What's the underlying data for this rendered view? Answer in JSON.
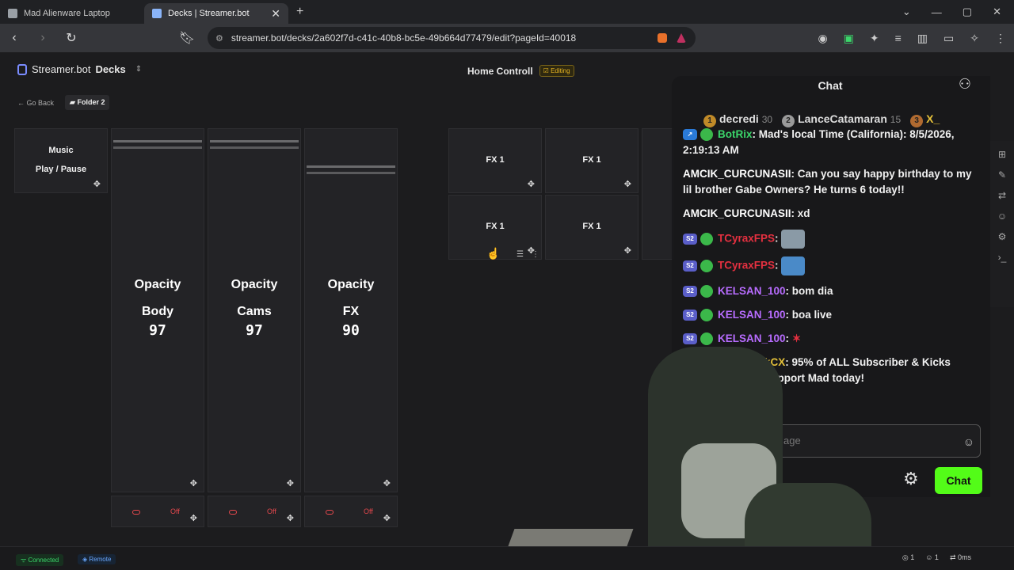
{
  "browser": {
    "tabs": [
      {
        "title": "Mad Alienware Laptop",
        "active": false
      },
      {
        "title": "Decks | Streamer.bot",
        "active": true
      }
    ],
    "new_tab": "+",
    "window_controls": [
      "⌄",
      "—",
      "▢",
      "✕"
    ],
    "url": "streamer.bot/decks/2a602f7d-c41c-40b8-bc5e-49b664d77479/edit?pageId=40018"
  },
  "header": {
    "brand": "Streamer.bot",
    "brand_section": "Decks",
    "page_title": "Home Controll",
    "editing_badge": "Editing"
  },
  "breadcrumb": {
    "back": "Go Back",
    "folder": "Folder 2"
  },
  "buttons": {
    "music": {
      "line1": "Music",
      "line2": "Play / Pause"
    },
    "fx": [
      "FX 1",
      "FX 1",
      "FX 1",
      "FX 1"
    ]
  },
  "sliders": [
    {
      "title": "Opacity",
      "target": "Body",
      "value": "97",
      "toggle": "Off"
    },
    {
      "title": "Opacity",
      "target": "Cams",
      "value": "97",
      "toggle": "Off"
    },
    {
      "title": "Opacity",
      "target": "FX",
      "value": "90",
      "toggle": "Off"
    }
  ],
  "chat": {
    "title": "Chat",
    "leaderboard": [
      {
        "rank": "1",
        "name": "decredi",
        "count": "30"
      },
      {
        "rank": "2",
        "name": "LanceCatamaran",
        "count": "15"
      },
      {
        "rank": "3",
        "name": "X_",
        "count": ""
      }
    ],
    "messages": [
      {
        "user": "BotRix",
        "text": ": Mad's local Time (California): 8/5/2026, 2:19:13 AM"
      },
      {
        "user": "AMCIK_CURCUNASII",
        "text": ": Can you say happy birthday to my lil brother Gabe Owners? He turns 6 today!!"
      },
      {
        "user": "AMCIK_CURCUNASII",
        "text": ": xd"
      },
      {
        "user": "TCyraxFPS",
        "text": ":"
      },
      {
        "user": "TCyraxFPS",
        "text": ":"
      },
      {
        "user": "KELSAN_100",
        "text": ": bom dia"
      },
      {
        "user": "KELSAN_100",
        "text": ": boa live"
      },
      {
        "user": "KELSAN_100",
        "text": ":"
      },
      {
        "user": "KickCX",
        "text": ": 95% of ALL Subscriber & Kicks goes to MadTV. Support Mad today!"
      }
    ],
    "input_placeholder": "age",
    "send_label": "Chat"
  },
  "status": {
    "connected": "Connected",
    "remote": "Remote",
    "stats": [
      "1",
      "1",
      "0ms"
    ]
  },
  "colors": {
    "accent_green": "#53fc18",
    "toggle_red": "#e5484d",
    "badge_yellow": "#e6b422"
  }
}
